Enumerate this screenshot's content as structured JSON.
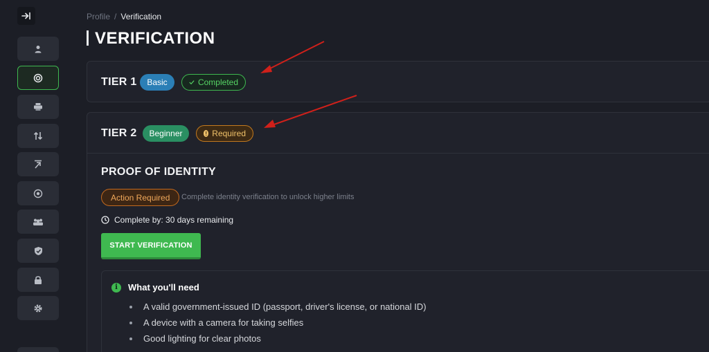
{
  "breadcrumb": {
    "parent": "Profile",
    "separator": "/",
    "current": "Verification"
  },
  "page": {
    "title": "VERIFICATION"
  },
  "sidebar": {
    "toggle_icon": "collapse-arrow-icon",
    "items": [
      {
        "name": "user-icon",
        "active": false
      },
      {
        "name": "target-icon",
        "active": true
      },
      {
        "name": "printer-icon",
        "active": false
      },
      {
        "name": "transfer-icon",
        "active": false
      },
      {
        "name": "arrow-tool-icon",
        "active": false
      },
      {
        "name": "eye-icon",
        "active": false
      },
      {
        "name": "group-icon",
        "active": false
      },
      {
        "name": "shield-check-icon",
        "active": false
      },
      {
        "name": "lock-icon",
        "active": false
      },
      {
        "name": "gear-icon",
        "active": false
      }
    ]
  },
  "tier1": {
    "label": "TIER 1",
    "level_badge": "Basic",
    "status_badge": "Completed"
  },
  "tier2": {
    "label": "TIER 2",
    "level_badge": "Beginner",
    "status_badge": "Required",
    "section_title": "PROOF OF IDENTITY",
    "action_badge": "Action Required",
    "action_description": "Complete identity verification to unlock higher limits",
    "deadline": "Complete by: 30 days remaining",
    "start_button": "START VERIFICATION",
    "needs": {
      "title": "What you'll need",
      "items": [
        "A valid government-issued ID (passport, driver's license, or national ID)",
        "A device with a camera for taking selfies",
        "Good lighting for clear photos"
      ]
    }
  },
  "colors": {
    "background": "#1c1e26",
    "card": "#20222b",
    "accent_green": "#3fb950",
    "basic_blue": "#2b7fb6",
    "beginner_green": "#2a8f62",
    "required_orange": "#c47a1e",
    "annotation_red": "#d0201a"
  }
}
